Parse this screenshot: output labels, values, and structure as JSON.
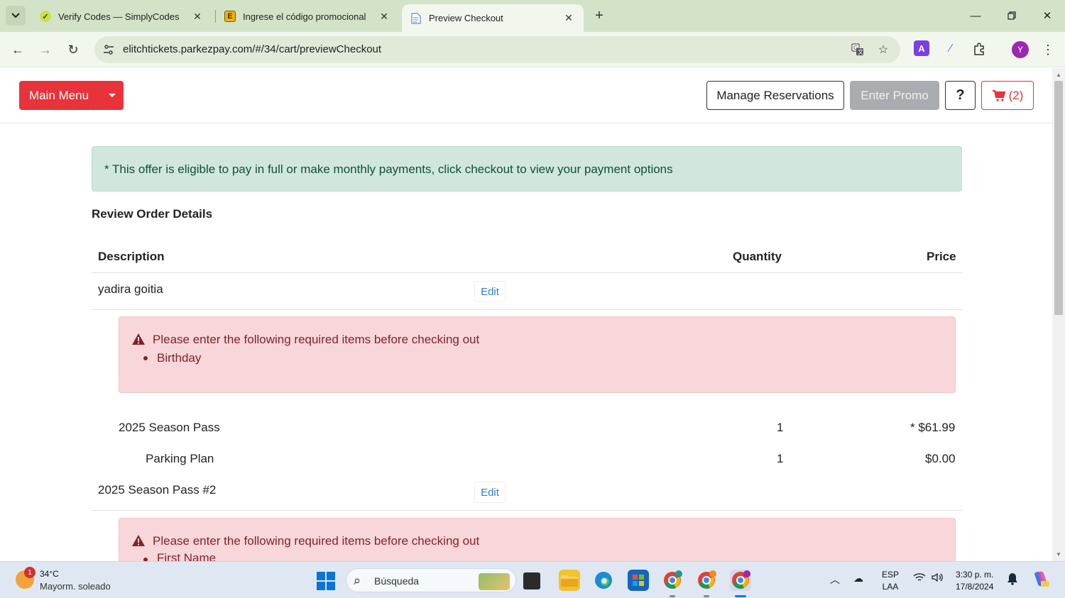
{
  "browser": {
    "tabs": [
      {
        "title": "Verify Codes — SimplyCodes",
        "icon": "simplycodes-icon",
        "active": false
      },
      {
        "title": "Ingrese el código promocional",
        "icon": "e-site-icon",
        "active": false
      },
      {
        "title": "Preview Checkout",
        "icon": "page-icon",
        "active": true
      }
    ],
    "url": "elitchtickets.parkezpay.com/#/34/cart/previewCheckout",
    "profile_initial": "Y"
  },
  "site": {
    "main_menu_label": "Main Menu",
    "manage_reservations_label": "Manage Reservations",
    "enter_promo_label": "Enter Promo",
    "help_label": "?",
    "cart_count": "(2)"
  },
  "info_alert": "* This offer is eligible to pay in full or make monthly payments, click checkout to view your payment options",
  "review_title": "Review Order Details",
  "table": {
    "headers": {
      "description": "Description",
      "quantity": "Quantity",
      "price": "Price"
    },
    "groups": [
      {
        "name": "yadira goitia",
        "edit_label": "Edit",
        "alert_message": "Please enter the following required items before checking out",
        "missing": [
          "Birthday"
        ],
        "items": [
          {
            "description": "2025 Season Pass",
            "quantity": "1",
            "price": "* $61.99"
          },
          {
            "description": "Parking Plan",
            "quantity": "1",
            "price": "$0.00"
          }
        ]
      },
      {
        "name": "2025 Season Pass #2",
        "edit_label": "Edit",
        "alert_message": "Please enter the following required items before checking out",
        "missing": [
          "First Name"
        ]
      }
    ]
  },
  "taskbar": {
    "weather_temp": "34°C",
    "weather_desc": "Mayorm. soleado",
    "weather_badge": "1",
    "search_placeholder": "Búsqueda",
    "lang_top": "ESP",
    "lang_bottom": "LAA",
    "time": "3:30 p. m.",
    "date": "17/8/2024"
  },
  "colors": {
    "brand_red": "#e8333a",
    "info_bg": "#d1e7dd",
    "danger_bg": "#f8d7da",
    "chrome_bg": "#d3e3c8"
  }
}
